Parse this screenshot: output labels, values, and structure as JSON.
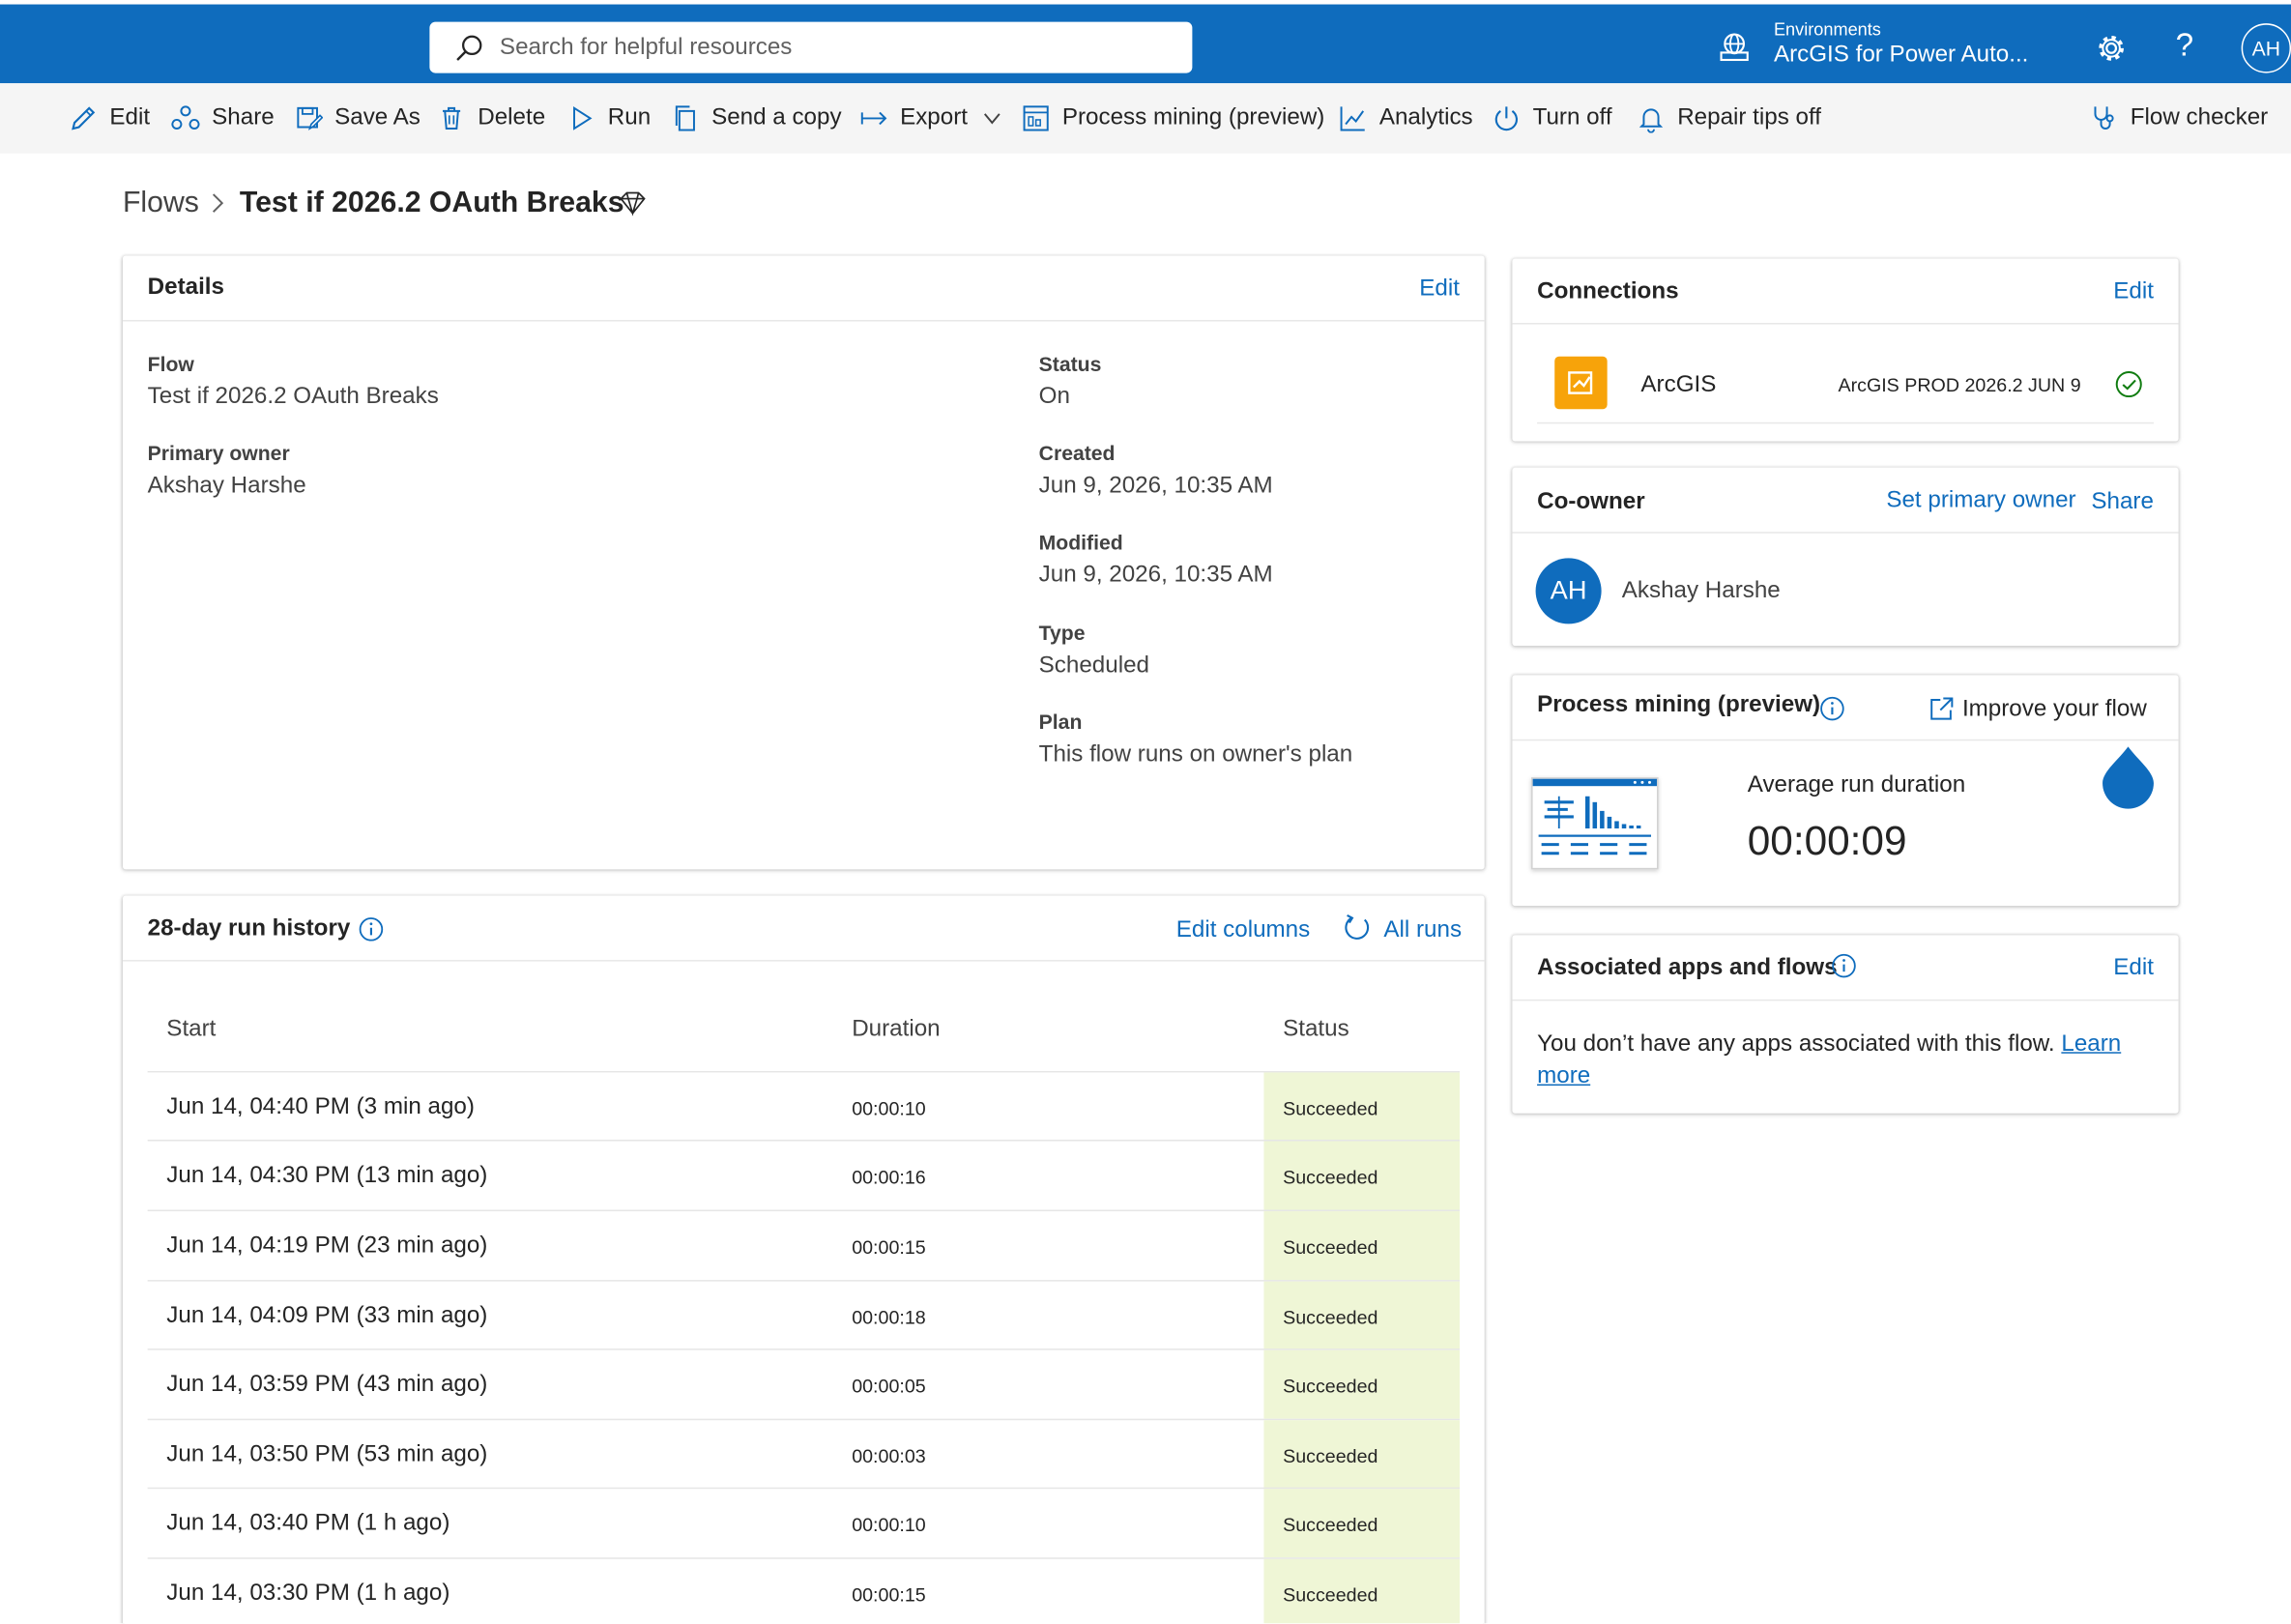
{
  "header": {
    "search_placeholder": "Search for helpful resources",
    "environment_label": "Environments",
    "environment_name": "ArcGIS for Power Auto...",
    "avatar_initials": "AH"
  },
  "toolbar": {
    "edit": "Edit",
    "share": "Share",
    "save_as": "Save As",
    "delete": "Delete",
    "run": "Run",
    "send_copy": "Send a copy",
    "export": "Export",
    "process_mining": "Process mining (preview)",
    "analytics": "Analytics",
    "turn_off": "Turn off",
    "repair_tips": "Repair tips off",
    "flow_checker": "Flow checker"
  },
  "breadcrumb": {
    "root": "Flows",
    "current": "Test if 2026.2 OAuth Breaks"
  },
  "details": {
    "title": "Details",
    "edit": "Edit",
    "flow_label": "Flow",
    "flow_value": "Test if 2026.2 OAuth Breaks",
    "owner_label": "Primary owner",
    "owner_value": "Akshay Harshe",
    "status_label": "Status",
    "status_value": "On",
    "created_label": "Created",
    "created_value": "Jun 9, 2026, 10:35 AM",
    "modified_label": "Modified",
    "modified_value": "Jun 9, 2026, 10:35 AM",
    "type_label": "Type",
    "type_value": "Scheduled",
    "plan_label": "Plan",
    "plan_value": "This flow runs on owner's plan"
  },
  "run_history": {
    "title": "28-day run history",
    "edit_columns": "Edit columns",
    "all_runs": "All runs",
    "columns": [
      "Start",
      "Duration",
      "Status"
    ],
    "rows": [
      {
        "start": "Jun 14, 04:40 PM (3 min ago)",
        "duration": "00:00:10",
        "status": "Succeeded"
      },
      {
        "start": "Jun 14, 04:30 PM (13 min ago)",
        "duration": "00:00:16",
        "status": "Succeeded"
      },
      {
        "start": "Jun 14, 04:19 PM (23 min ago)",
        "duration": "00:00:15",
        "status": "Succeeded"
      },
      {
        "start": "Jun 14, 04:09 PM (33 min ago)",
        "duration": "00:00:18",
        "status": "Succeeded"
      },
      {
        "start": "Jun 14, 03:59 PM (43 min ago)",
        "duration": "00:00:05",
        "status": "Succeeded"
      },
      {
        "start": "Jun 14, 03:50 PM (53 min ago)",
        "duration": "00:00:03",
        "status": "Succeeded"
      },
      {
        "start": "Jun 14, 03:40 PM (1 h ago)",
        "duration": "00:00:10",
        "status": "Succeeded"
      },
      {
        "start": "Jun 14, 03:30 PM (1 h ago)",
        "duration": "00:00:15",
        "status": "Succeeded"
      }
    ]
  },
  "connections": {
    "title": "Connections",
    "edit": "Edit",
    "name": "ArcGIS",
    "detail": "ArcGIS PROD 2026.2 JUN 9",
    "icon_color": "#f7a30a"
  },
  "coowner": {
    "title": "Co-owner",
    "set_primary": "Set primary owner",
    "share": "Share",
    "initials": "AH",
    "name": "Akshay Harshe"
  },
  "process_mining": {
    "title": "Process mining (preview)",
    "improve": "Improve your flow",
    "metric_label": "Average run duration",
    "metric_value": "00:00:09"
  },
  "associated": {
    "title": "Associated apps and flows",
    "edit": "Edit",
    "message": "You don’t have any apps associated with this flow.",
    "learn_1": "Learn",
    "learn_2": "more"
  },
  "colors": {
    "brand": "#0f6cbd",
    "success_cell": "#eff6d6"
  }
}
